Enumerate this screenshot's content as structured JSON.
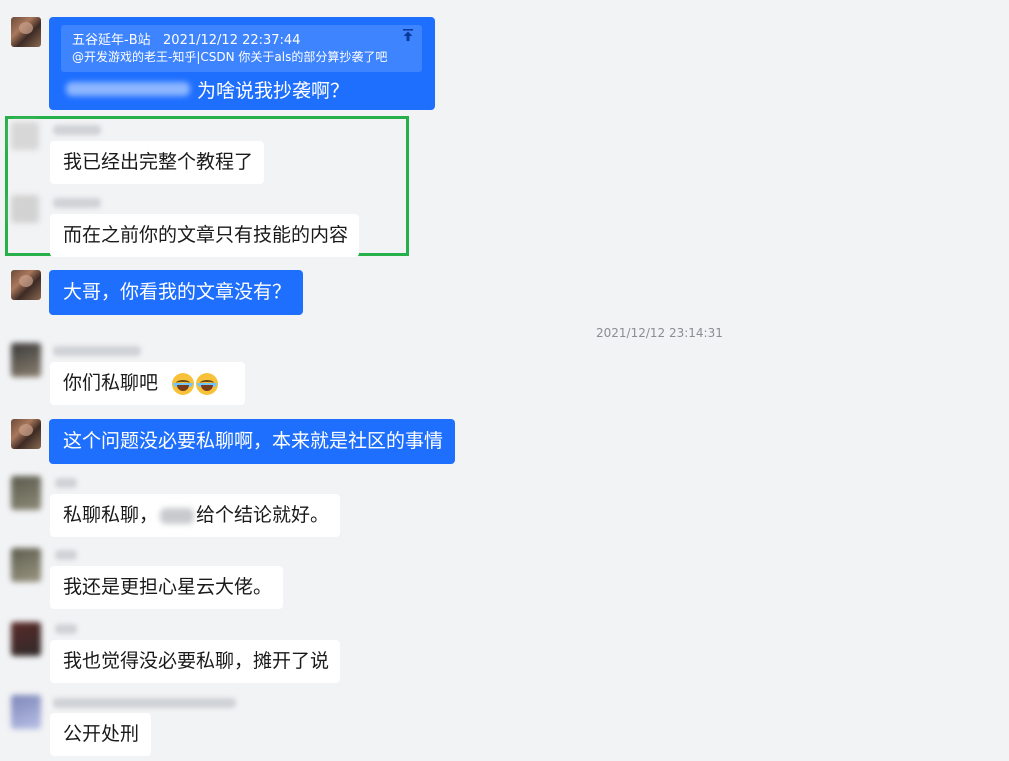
{
  "quoted_message": {
    "source": "五谷延年-B站",
    "timestamp": "2021/12/12 22:37:44",
    "text": "@开发游戏的老王-知乎|CSDN 你关于als的部分算抄袭了吧",
    "icon": "pin-top-icon"
  },
  "messages": [
    {
      "text": "为啥说我抄袭啊？",
      "direction": "outgoing"
    },
    {
      "text": "我已经出完整个教程了",
      "direction": "incoming"
    },
    {
      "text": "而在之前你的文章只有技能的内容",
      "direction": "incoming"
    },
    {
      "text": "大哥，你看我的文章没有？",
      "direction": "outgoing"
    },
    {
      "text": "你们私聊吧",
      "direction": "incoming",
      "emoji": "laughing-tears-icon"
    },
    {
      "text": "这个问题没必要私聊啊，本来就是社区的事情",
      "direction": "outgoing"
    },
    {
      "text_before": "私聊私聊，",
      "text_after": "给个结论就好。",
      "direction": "incoming"
    },
    {
      "text": "我还是更担心星云大佬。",
      "direction": "incoming"
    },
    {
      "text": "我也觉得没必要私聊，摊开了说",
      "direction": "incoming"
    },
    {
      "text": "公开处刑",
      "direction": "incoming"
    }
  ],
  "divider_timestamp": "2021/12/12 23:14:31",
  "colors": {
    "background": "#f2f3f5",
    "outgoing_bubble": "#1f6fff",
    "incoming_bubble": "#ffffff",
    "highlight_border": "#27b04a"
  }
}
